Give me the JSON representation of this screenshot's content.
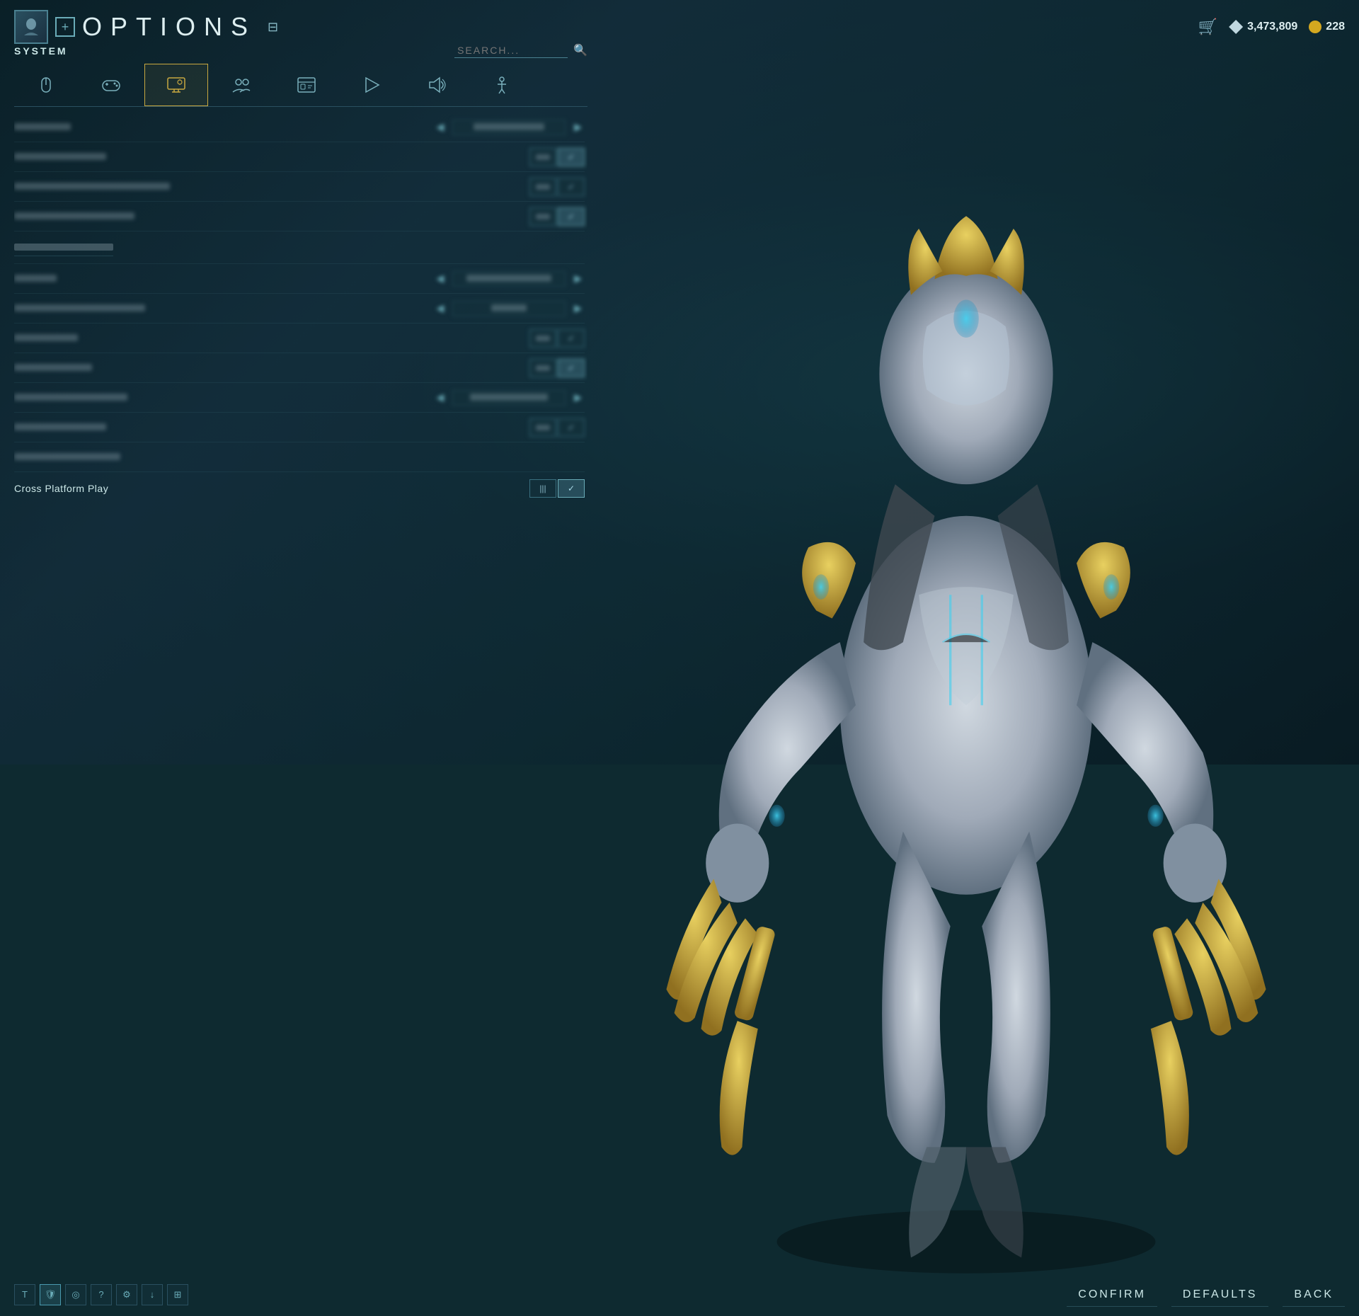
{
  "header": {
    "title": "OPTIONS",
    "plus_label": "+",
    "section": "SYSTEM",
    "search_placeholder": "SEARCH...",
    "currency_plat": "3,473,809",
    "currency_credit": "228"
  },
  "tabs": [
    {
      "id": "mouse",
      "label": "🖱",
      "icon": "mouse-icon",
      "active": false
    },
    {
      "id": "controller",
      "label": "🎮",
      "icon": "controller-icon",
      "active": false
    },
    {
      "id": "display",
      "label": "⚙",
      "icon": "display-icon",
      "active": true
    },
    {
      "id": "social",
      "label": "👥",
      "icon": "social-icon",
      "active": false
    },
    {
      "id": "interface",
      "label": "🖥",
      "icon": "interface-icon",
      "active": false
    },
    {
      "id": "gameplay",
      "label": "▶",
      "icon": "gameplay-icon",
      "active": false
    },
    {
      "id": "audio",
      "label": "🔊",
      "icon": "audio-icon",
      "active": false
    },
    {
      "id": "accessibility",
      "label": "♿",
      "icon": "accessibility-icon",
      "active": false
    }
  ],
  "settings": [
    {
      "id": "pc-type",
      "label": "PC Type",
      "blurred": true,
      "type": "arrows",
      "value": "XXXXXXXX"
    },
    {
      "id": "row2",
      "label": "XXXXXXXXXX",
      "blurred": true,
      "type": "toggle",
      "state": "check"
    },
    {
      "id": "row3",
      "label": "XXXXXXXXXXXXXXXXXXXXXXX",
      "blurred": true,
      "type": "toggle",
      "state": "off"
    },
    {
      "id": "row4",
      "label": "XXXXXXXXXXXXXXXXX",
      "blurred": true,
      "type": "toggle",
      "state": "check"
    },
    {
      "id": "section1",
      "label": "« XXXXXXXX »",
      "blurred": true,
      "type": "section"
    },
    {
      "id": "region",
      "label": "XXXXX",
      "blurred": true,
      "type": "arrows",
      "value": "XXXXXXXXXXXX"
    },
    {
      "id": "matchmaking",
      "label": "Matchmaking Ping Limit",
      "blurred": true,
      "type": "arrows",
      "value": "XXX"
    },
    {
      "id": "squad-afk",
      "label": "Squad AFK",
      "blurred": true,
      "type": "toggle",
      "state": "off"
    },
    {
      "id": "squad-afk-msg",
      "label": "Squad AFK MSG",
      "blurred": true,
      "type": "toggle",
      "state": "check"
    },
    {
      "id": "network-bandwidth",
      "label": "XXXXXXXXXXXXXXXX",
      "blurred": true,
      "type": "arrows",
      "value": "XXXXXXXXXX"
    },
    {
      "id": "enable-p2p",
      "label": "Enable P2P Chat",
      "blurred": true,
      "type": "toggle",
      "state": "off"
    },
    {
      "id": "region-privacy",
      "label": "XXXXXXXXXXXXXX",
      "blurred": true,
      "type": "none"
    }
  ],
  "cross_platform": {
    "label": "Cross Platform Play",
    "toggle_icon": "|||",
    "check_icon": "✓"
  },
  "actions": {
    "confirm": "CONFIRM",
    "defaults": "DEFAULTS",
    "back": "BACK"
  },
  "bottom_icons": [
    {
      "id": "icon1",
      "symbol": "T",
      "active": false
    },
    {
      "id": "icon2",
      "symbol": "🛡",
      "active": true
    },
    {
      "id": "icon3",
      "symbol": "◎",
      "active": false
    },
    {
      "id": "icon4",
      "symbol": "?",
      "active": false
    },
    {
      "id": "icon5",
      "symbol": "⚙",
      "active": false
    },
    {
      "id": "icon6",
      "symbol": "↓",
      "active": false
    },
    {
      "id": "icon7",
      "symbol": "⊞",
      "active": false
    }
  ]
}
